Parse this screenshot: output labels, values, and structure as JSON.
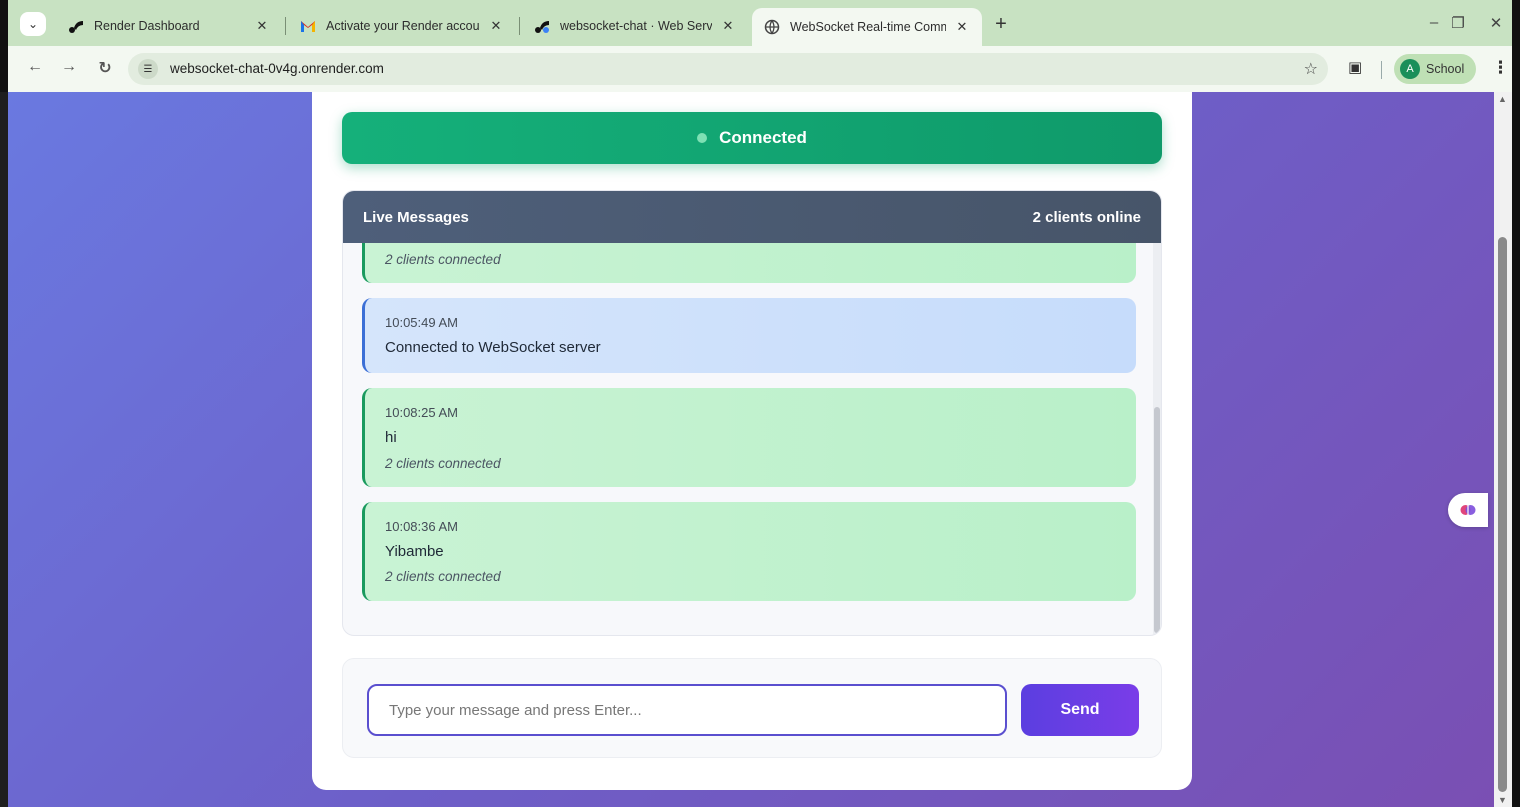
{
  "browser": {
    "tabs": [
      {
        "title": "Render Dashboard",
        "favicon": "render-logo-icon",
        "active": false
      },
      {
        "title": "Activate your Render account -",
        "favicon": "gmail-icon",
        "active": false
      },
      {
        "title": "websocket-chat · Web Service",
        "favicon": "render-logo-icon",
        "active": false
      },
      {
        "title": "WebSocket Real-time Commun",
        "favicon": "globe-icon",
        "active": true
      }
    ],
    "url": "websocket-chat-0v4g.onrender.com",
    "profile_label": "School",
    "profile_initial": "A"
  },
  "app": {
    "status_text": "Connected",
    "status_color": "#15b07a",
    "panel_title": "Live Messages",
    "clients_online": "2 clients online",
    "messages": [
      {
        "kind": "user",
        "time": "",
        "text": "",
        "meta": "2 clients connected"
      },
      {
        "kind": "system",
        "time": "10:05:49 AM",
        "text": "Connected to WebSocket server",
        "meta": ""
      },
      {
        "kind": "user",
        "time": "10:08:25 AM",
        "text": "hi",
        "meta": "2 clients connected"
      },
      {
        "kind": "user",
        "time": "10:08:36 AM",
        "text": "Yibambe",
        "meta": "2 clients connected"
      }
    ],
    "input_placeholder": "Type your message and press Enter...",
    "input_value": "",
    "send_label": "Send"
  }
}
